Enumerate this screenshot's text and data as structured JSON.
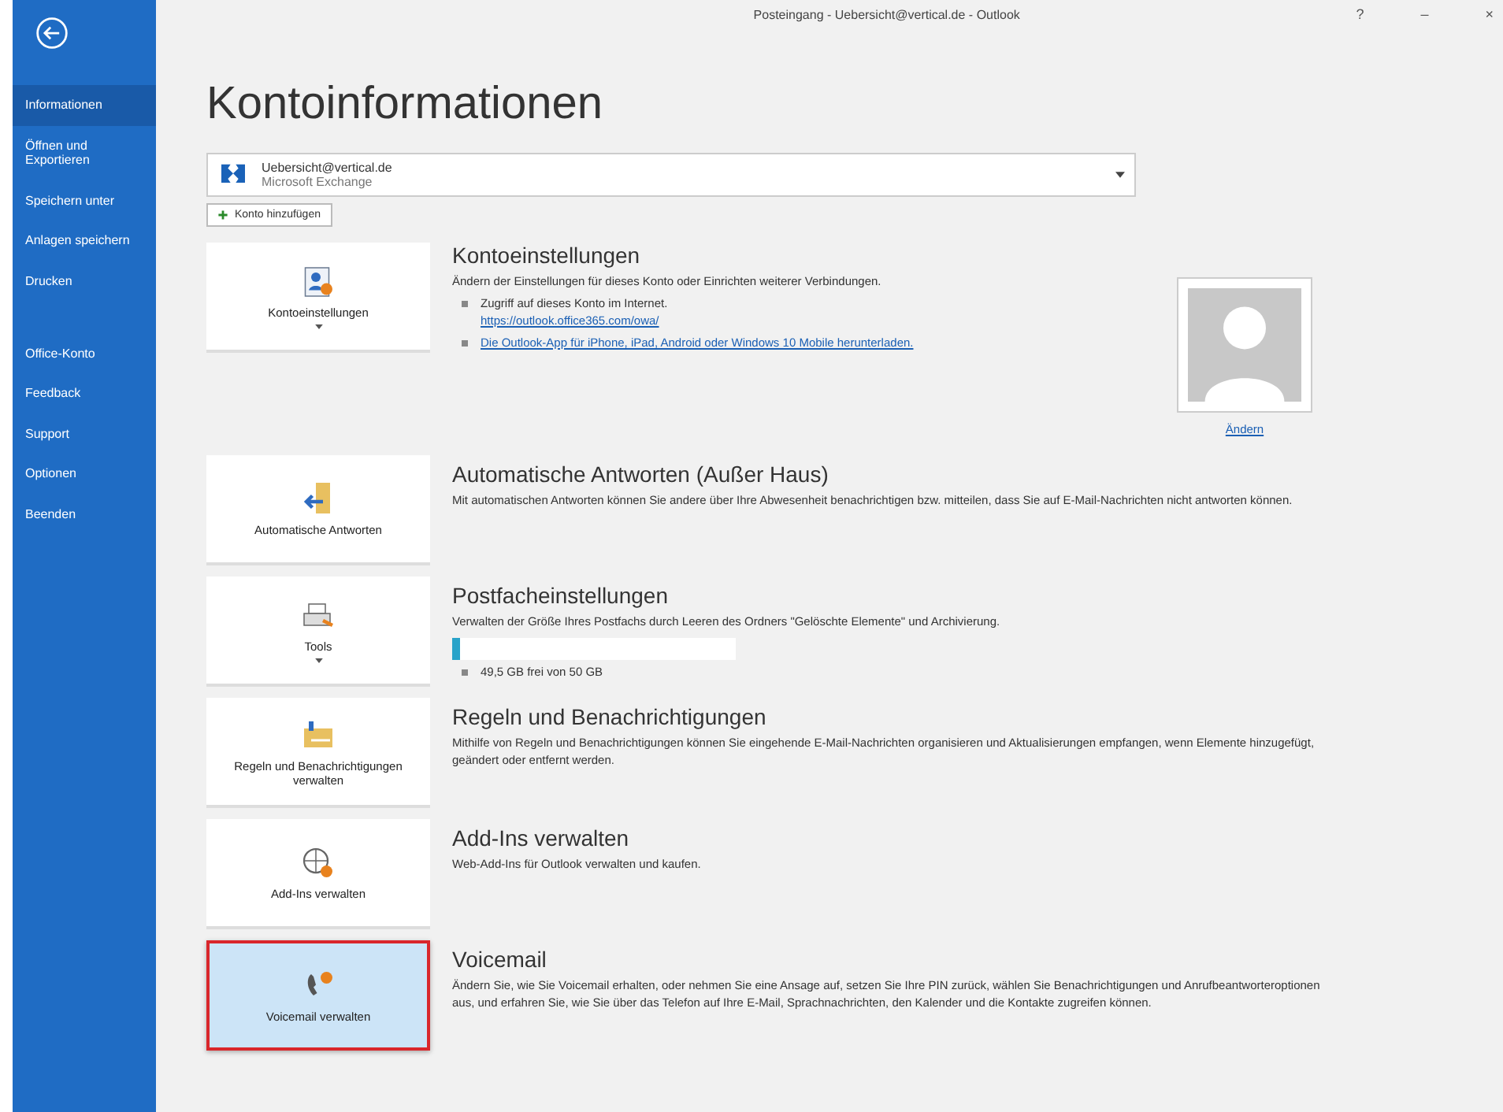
{
  "window": {
    "title": "Posteingang - Uebersicht@vertical.de - Outlook",
    "controls": [
      "?",
      "–",
      "×"
    ]
  },
  "sidebar": {
    "items": [
      {
        "label": "Informationen",
        "selected": true
      },
      {
        "label": "Öffnen und Exportieren",
        "selected": false
      },
      {
        "label": "Speichern unter",
        "selected": false
      },
      {
        "label": "Anlagen speichern",
        "selected": false
      },
      {
        "label": "Drucken",
        "selected": false
      },
      {
        "label": "Office-Konto",
        "selected": false
      },
      {
        "label": "Feedback",
        "selected": false
      },
      {
        "label": "Support",
        "selected": false
      },
      {
        "label": "Optionen",
        "selected": false
      },
      {
        "label": "Beenden",
        "selected": false
      }
    ]
  },
  "heading": "Kontoinformationen",
  "account": {
    "name": "Uebersicht@vertical.de",
    "type": "Microsoft Exchange",
    "add_button": "Konto hinzufügen"
  },
  "sections": [
    {
      "kind": "account",
      "button": "Kontoeinstellungen",
      "dropdown": true,
      "selected": false,
      "title": "Kontoeinstellungen",
      "text": "Ändern der Einstellungen für dieses Konto oder Einrichten weiterer Verbindungen.",
      "bullets": [
        {
          "text": "Zugriff auf dieses Konto im Internet.",
          "link": "https://outlook.office365.com/owa/"
        },
        {
          "link": "Die Outlook-App für iPhone, iPad, Android oder Windows 10 Mobile herunterladen."
        }
      ],
      "photo_link": "Ändern"
    },
    {
      "kind": "auto",
      "button": "Automatische Antworten",
      "dropdown": false,
      "selected": false,
      "title": "Automatische Antworten (Außer Haus)",
      "text": "Mit automatischen Antworten können Sie andere über Ihre Abwesenheit benachrichtigen bzw. mitteilen, dass Sie auf E-Mail-Nachrichten nicht antworten können."
    },
    {
      "kind": "tools",
      "button": "Tools",
      "dropdown": true,
      "selected": false,
      "title": "Postfacheinstellungen",
      "text": "Verwalten der Größe Ihres Postfachs durch Leeren des Ordners \"Gelöschte Elemente\" und Archivierung.",
      "quota": {
        "level": 0.03,
        "reading": "49,5 GB frei von 50 GB"
      }
    },
    {
      "kind": "rules",
      "button": "Regeln und Benachrichtigungen verwalten",
      "dropdown": false,
      "selected": false,
      "title": "Regeln und Benachrichtigungen",
      "text": "Mithilfe von Regeln und Benachrichtigungen können Sie eingehende E-Mail-Nachrichten organisieren und Aktualisierungen empfangen, wenn Elemente hinzugefügt, geändert oder entfernt werden."
    },
    {
      "kind": "addins",
      "button": "Add-Ins verwalten",
      "dropdown": false,
      "selected": false,
      "title": "Add-Ins verwalten",
      "text": "Web-Add-Ins für Outlook verwalten und kaufen."
    },
    {
      "kind": "voicemail",
      "button": "Voicemail verwalten",
      "dropdown": false,
      "selected": true,
      "title": "Voicemail",
      "text": "Ändern Sie, wie Sie Voicemail erhalten, oder nehmen Sie eine Ansage auf, setzen Sie Ihre PIN zurück, wählen Sie Benachrichtigungen und Anrufbeantworteroptionen aus, und erfahren Sie, wie Sie über das Telefon auf Ihre E-Mail, Sprachnachrichten, den Kalender und die Kontakte zugreifen können."
    }
  ]
}
